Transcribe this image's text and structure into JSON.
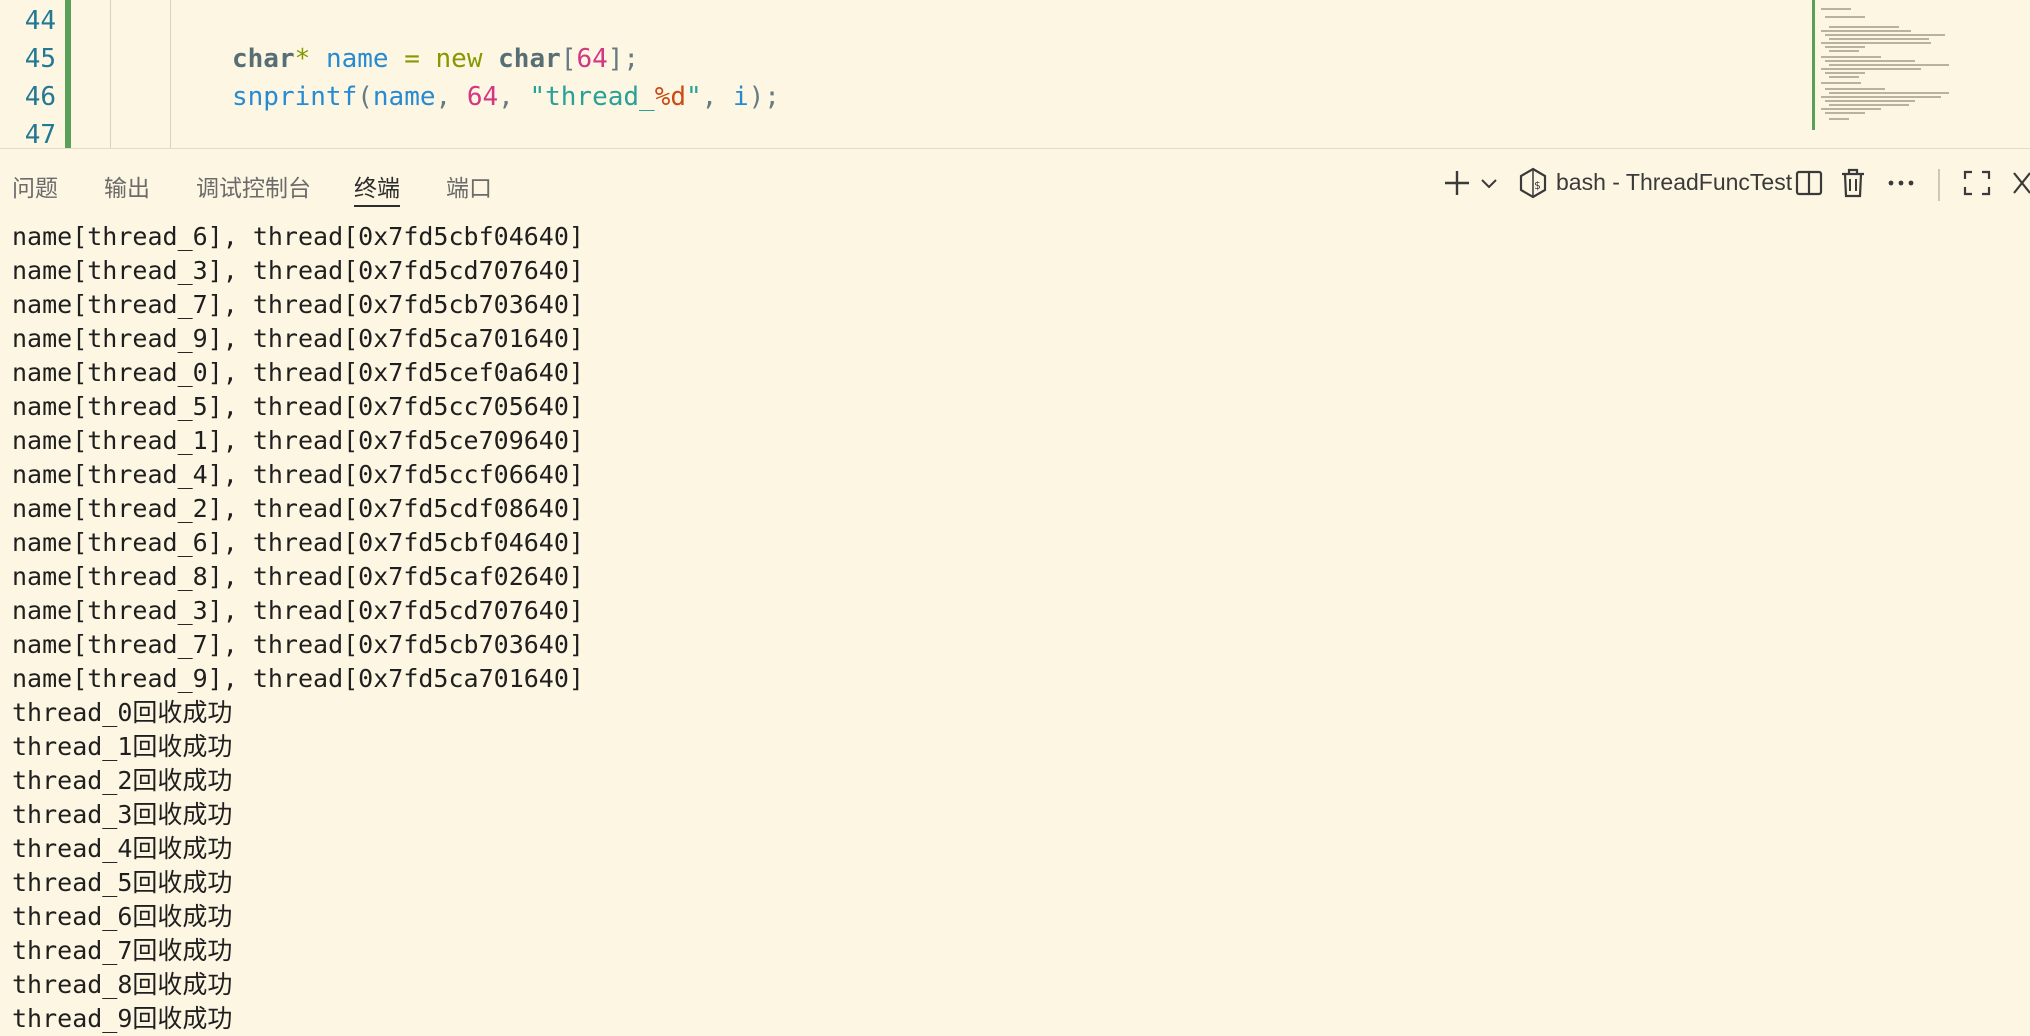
{
  "editor": {
    "lines": [
      {
        "num": "44"
      },
      {
        "num": "45",
        "tokens": [
          {
            "t": "char",
            "c": "type"
          },
          {
            "t": "* ",
            "c": "op"
          },
          {
            "t": "name",
            "c": "var"
          },
          {
            "t": " = ",
            "c": "op"
          },
          {
            "t": "new ",
            "c": "kw"
          },
          {
            "t": "char",
            "c": "type"
          },
          {
            "t": "[",
            "c": "pun"
          },
          {
            "t": "64",
            "c": "num"
          },
          {
            "t": "];",
            "c": "pun"
          }
        ]
      },
      {
        "num": "46",
        "tokens": [
          {
            "t": "snprintf",
            "c": "fn"
          },
          {
            "t": "(",
            "c": "pun"
          },
          {
            "t": "name",
            "c": "var"
          },
          {
            "t": ", ",
            "c": "pun"
          },
          {
            "t": "64",
            "c": "num"
          },
          {
            "t": ", ",
            "c": "pun"
          },
          {
            "t": "\"thread_",
            "c": "str"
          },
          {
            "t": "%d",
            "c": "fmt"
          },
          {
            "t": "\"",
            "c": "str"
          },
          {
            "t": ", ",
            "c": "pun"
          },
          {
            "t": "i",
            "c": "var"
          },
          {
            "t": ");",
            "c": "pun"
          }
        ]
      },
      {
        "num": "47"
      }
    ]
  },
  "panel": {
    "tabs": [
      {
        "label": "问题",
        "active": false
      },
      {
        "label": "输出",
        "active": false
      },
      {
        "label": "调试控制台",
        "active": false
      },
      {
        "label": "终端",
        "active": true
      },
      {
        "label": "端口",
        "active": false
      }
    ],
    "terminal_title": "bash - ThreadFuncTest",
    "icons": {
      "add": "plus-icon",
      "dropdown": "chevron-down-icon",
      "shell": "bash-shell-icon",
      "split": "split-terminal-icon",
      "kill": "trash-icon",
      "more": "more-actions-icon",
      "maximize": "maximize-panel-icon",
      "close": "close-panel-icon"
    }
  },
  "terminal": {
    "output_lines": [
      "name[thread_6], thread[0x7fd5cbf04640]",
      "name[thread_3], thread[0x7fd5cd707640]",
      "name[thread_7], thread[0x7fd5cb703640]",
      "name[thread_9], thread[0x7fd5ca701640]",
      "name[thread_0], thread[0x7fd5cef0a640]",
      "name[thread_5], thread[0x7fd5cc705640]",
      "name[thread_1], thread[0x7fd5ce709640]",
      "name[thread_4], thread[0x7fd5ccf06640]",
      "name[thread_2], thread[0x7fd5cdf08640]",
      "name[thread_6], thread[0x7fd5cbf04640]",
      "name[thread_8], thread[0x7fd5caf02640]",
      "name[thread_3], thread[0x7fd5cd707640]",
      "name[thread_7], thread[0x7fd5cb703640]",
      "name[thread_9], thread[0x7fd5ca701640]"
    ],
    "reclaim_lines": [
      {
        "name": "thread_0",
        "msg": "回收成功"
      },
      {
        "name": "thread_1",
        "msg": "回收成功"
      },
      {
        "name": "thread_2",
        "msg": "回收成功"
      },
      {
        "name": "thread_3",
        "msg": "回收成功"
      },
      {
        "name": "thread_4",
        "msg": "回收成功"
      },
      {
        "name": "thread_5",
        "msg": "回收成功"
      },
      {
        "name": "thread_6",
        "msg": "回收成功"
      },
      {
        "name": "thread_7",
        "msg": "回收成功"
      },
      {
        "name": "thread_8",
        "msg": "回收成功"
      },
      {
        "name": "thread_9",
        "msg": "回收成功"
      }
    ]
  }
}
